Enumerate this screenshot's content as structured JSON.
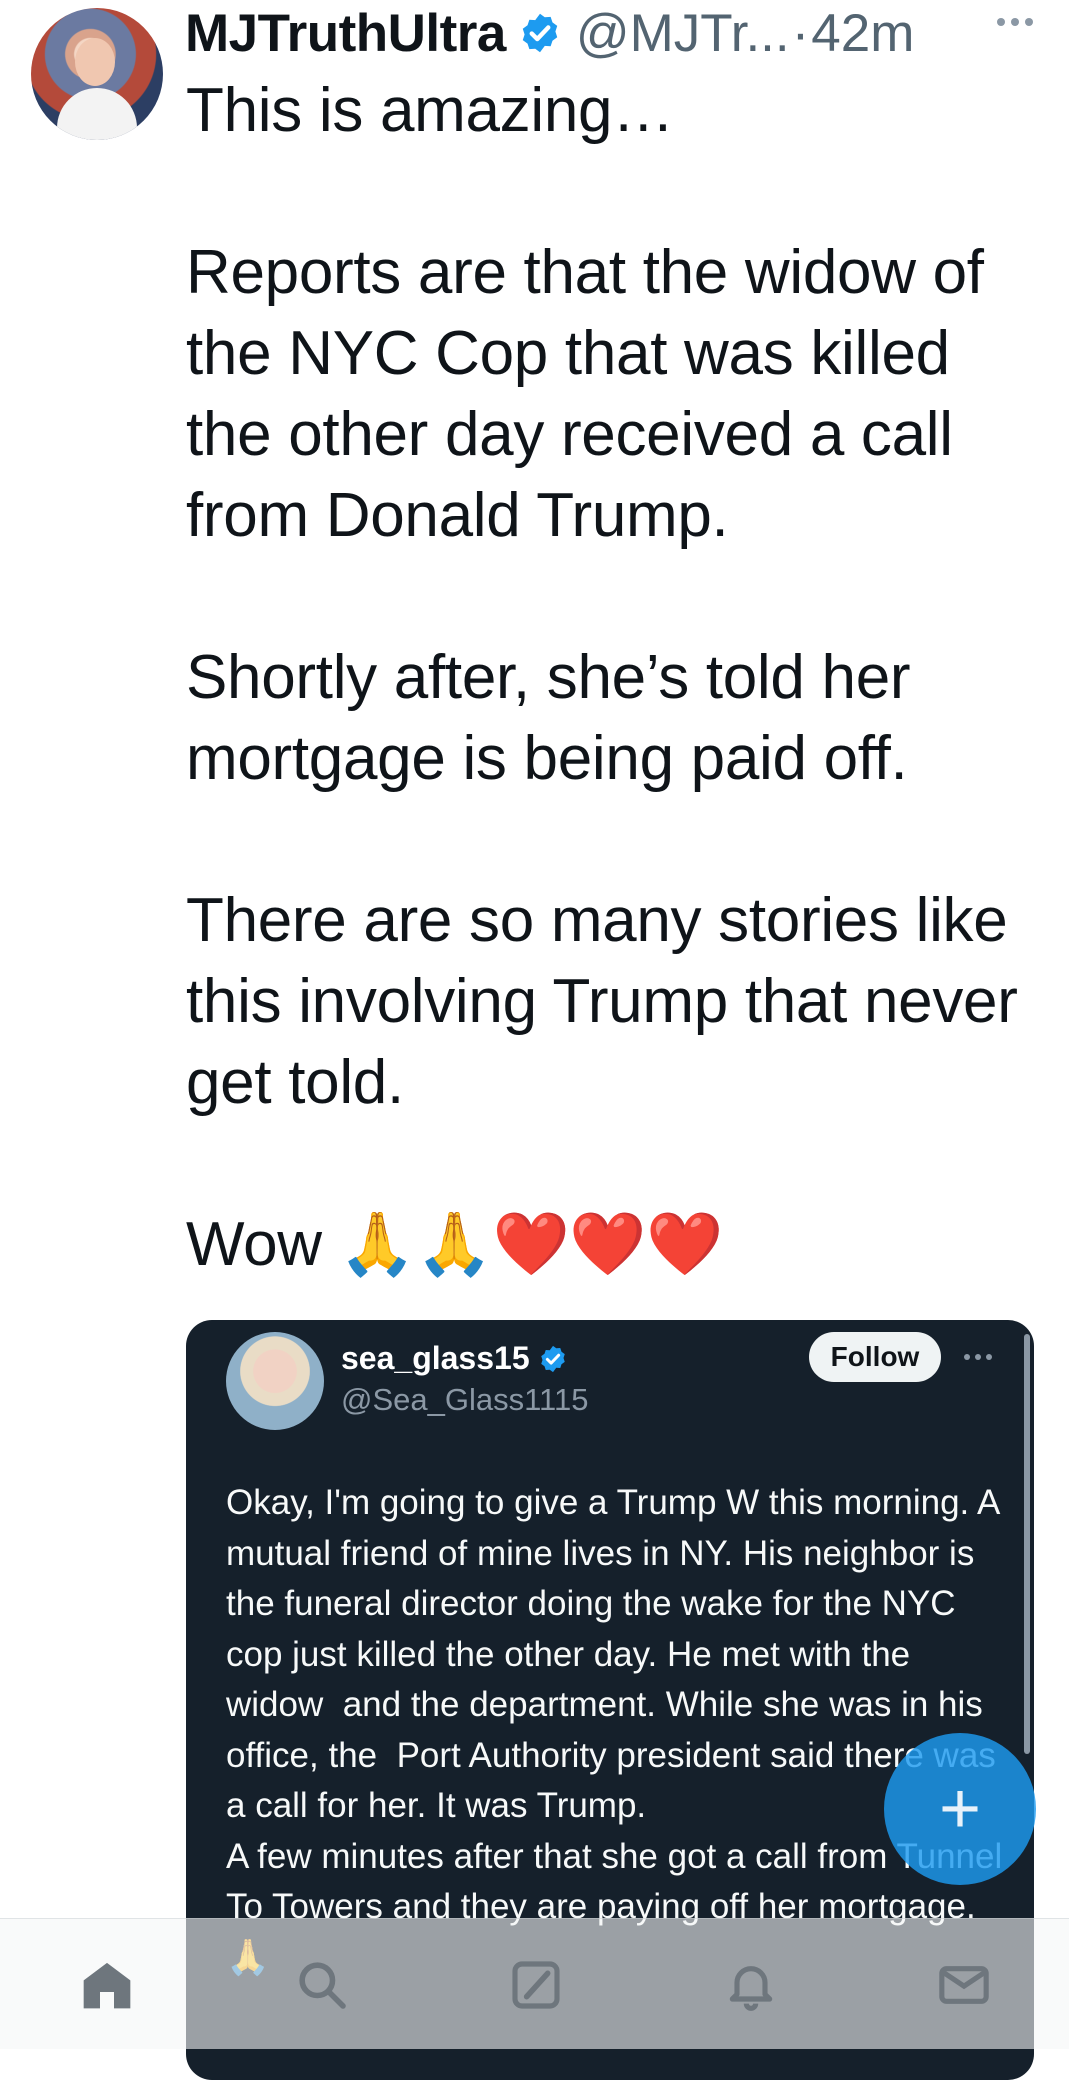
{
  "author": {
    "display_name": "MJTruthUltra",
    "handle": "@MJTr...",
    "separator": "·",
    "time_ago": "42m",
    "verified": true
  },
  "tweet": {
    "text": "This is amazing…\n\nReports are that the widow of the NYC Cop that was killed the other day received a call from Donald Trump.\n\nShortly after, she’s told her mortgage is being paid off.\n\nThere are so many stories like this involving Trump that never get told.\n\nWow 🙏🙏❤️❤️❤️"
  },
  "embedded_post": {
    "display_name": "sea_glass15",
    "handle": "@Sea_Glass1115",
    "follow_label": "Follow",
    "verified": true,
    "text": "Okay, I'm going to give a Trump W this morning. A mutual friend of mine lives in NY. His neighbor is the funeral director doing the wake for the NYC cop just killed the other day. He met with the widow  and the department. While she was in his office, the  Port Authority president said there was a call for her. It was Trump.\nA few minutes after that she got a call from Tunnel To Towers and they are paying off her mortgage. 🙏"
  },
  "compose_fab": {
    "icon": "plus-icon",
    "symbol": "+"
  },
  "bottom_nav": {
    "items": [
      "home-icon",
      "search-icon",
      "grok-icon",
      "notifications-icon",
      "messages-icon"
    ]
  },
  "colors": {
    "accent": "#1d9bf0",
    "embed_background": "#15202b",
    "secondary_text": "#536471"
  }
}
